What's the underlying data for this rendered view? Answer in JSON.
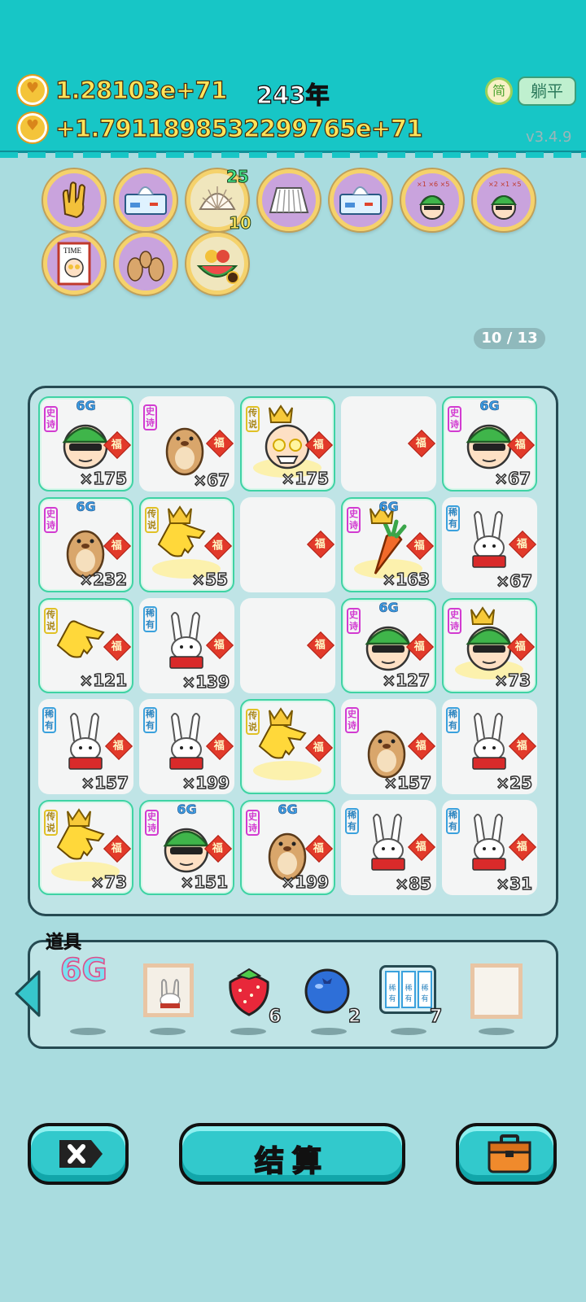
{
  "header": {
    "total_money": "1.28103e+71",
    "income": "+1.7911898532299765e+71",
    "year": "243年",
    "simplified_label": "简",
    "lie_flat_label": "躺平",
    "version": "v3.4.9"
  },
  "relics": {
    "shell_top_count": "25",
    "shell_bottom_count": "10",
    "items": [
      "rock-hand",
      "tissue-box",
      "shell",
      "pleated-skirt",
      "tissue-box",
      "green-hat-man-money",
      "green-hat-man-money",
      "time-magazine",
      "marmot-family",
      "fruit-basket"
    ]
  },
  "page_counter": "10 / 13",
  "board": {
    "cells": [
      {
        "rarity": "史诗",
        "count": "×175",
        "item": "green-hat-man",
        "sixg": "6G",
        "glow": true
      },
      {
        "rarity": "史诗",
        "count": "×67",
        "item": "marmot",
        "sixg": "",
        "glow": false
      },
      {
        "rarity": "传说",
        "count": "×175",
        "item": "king-bald-man",
        "sixg": "",
        "glow": true
      },
      {
        "rarity": "",
        "count": "",
        "item": "empty",
        "sixg": "",
        "glow": false
      },
      {
        "rarity": "史诗",
        "count": "×67",
        "item": "green-hat-man",
        "sixg": "6G",
        "glow": true
      },
      {
        "rarity": "史诗",
        "count": "×232",
        "item": "marmot",
        "sixg": "6G",
        "glow": true
      },
      {
        "rarity": "传说",
        "count": "×55",
        "item": "king-hand",
        "sixg": "",
        "glow": true
      },
      {
        "rarity": "",
        "count": "",
        "item": "empty",
        "sixg": "",
        "glow": false
      },
      {
        "rarity": "史诗",
        "count": "×163",
        "item": "king-carrot",
        "sixg": "6G",
        "glow": true
      },
      {
        "rarity": "稀有",
        "count": "×67",
        "item": "rabbit",
        "sixg": "",
        "glow": false
      },
      {
        "rarity": "传说",
        "count": "×121",
        "item": "hand",
        "sixg": "",
        "glow": true
      },
      {
        "rarity": "稀有",
        "count": "×139",
        "item": "rabbit",
        "sixg": "",
        "glow": false
      },
      {
        "rarity": "",
        "count": "",
        "item": "empty",
        "sixg": "",
        "glow": false
      },
      {
        "rarity": "史诗",
        "count": "×127",
        "item": "green-hat-man",
        "sixg": "6G",
        "glow": true
      },
      {
        "rarity": "史诗",
        "count": "×73",
        "item": "king-green-hat-man",
        "sixg": "",
        "glow": true
      },
      {
        "rarity": "稀有",
        "count": "×157",
        "item": "rabbit",
        "sixg": "",
        "glow": false
      },
      {
        "rarity": "稀有",
        "count": "×199",
        "item": "rabbit",
        "sixg": "",
        "glow": false
      },
      {
        "rarity": "传说",
        "count": "",
        "item": "king-hand",
        "sixg": "",
        "glow": true
      },
      {
        "rarity": "史诗",
        "count": "×157",
        "item": "marmot",
        "sixg": "",
        "glow": false
      },
      {
        "rarity": "稀有",
        "count": "×25",
        "item": "rabbit",
        "sixg": "",
        "glow": false
      },
      {
        "rarity": "传说",
        "count": "×73",
        "item": "king-hand",
        "sixg": "",
        "glow": true
      },
      {
        "rarity": "史诗",
        "count": "×151",
        "item": "green-hat-man",
        "sixg": "6G",
        "glow": true
      },
      {
        "rarity": "史诗",
        "count": "×199",
        "item": "marmot",
        "sixg": "6G",
        "glow": true
      },
      {
        "rarity": "稀有",
        "count": "×85",
        "item": "rabbit",
        "sixg": "",
        "glow": false
      },
      {
        "rarity": "稀有",
        "count": "×31",
        "item": "rabbit",
        "sixg": "",
        "glow": false
      }
    ],
    "fu_label": "福"
  },
  "items_panel": {
    "title": "道具",
    "six_g_label": "6G",
    "strawberry_count": "6",
    "blueberry_count": "2",
    "rare_pack_count": "7",
    "rare_pack_label": "稀有"
  },
  "buttons": {
    "settle_label": "结算"
  },
  "colors": {
    "header": "#17c6c6",
    "background": "#a9dcdf",
    "epic_tag": "#d23bd1",
    "legend_tag": "#e0c126",
    "rare_tag": "#3aa1dd",
    "fu_badge": "#e23a2a"
  }
}
